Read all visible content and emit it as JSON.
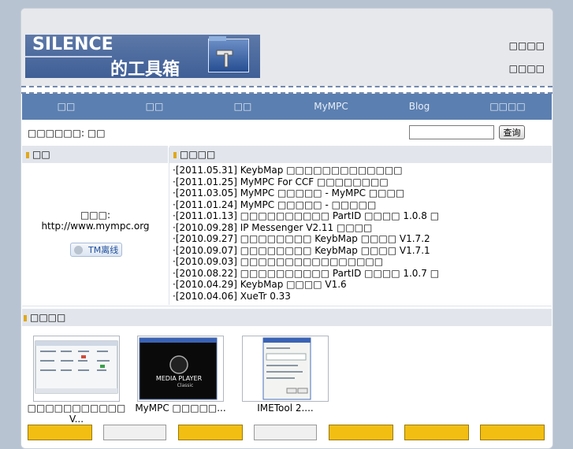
{
  "header": {
    "logo_line1": "SILENCE",
    "logo_line2": "的工具箱",
    "links": [
      "□□□□",
      "□□□□"
    ]
  },
  "nav": {
    "items": [
      "□□",
      "□□",
      "□□",
      "MyMPC",
      "Blog",
      "□□□□"
    ]
  },
  "location": {
    "label": "□□□□□□: □□",
    "search_value": "",
    "search_button": "查询"
  },
  "contact": {
    "heading": "□□",
    "label": "□□□:",
    "url": "http://www.mympc.org",
    "tm_status": "TM离线"
  },
  "news": {
    "heading": "□□□□",
    "items": [
      "·[2011.05.31] KeybMap □□□□□□□□□□□□□",
      "·[2011.01.25] MyMPC For CCF □□□□□□□□",
      "·[2011.03.05] MyMPC □□□□□ - MyMPC □□□□",
      "·[2011.01.24] MyMPC □□□□□ - □□□□□",
      "·[2011.01.13] □□□□□□□□□□ PartID □□□□ 1.0.8 □",
      "·[2010.09.28] IP Messenger V2.11 □□□□",
      "·[2010.09.27] □□□□□□□□ KeybMap □□□□ V1.7.2",
      "·[2010.09.07] □□□□□□□□ KeybMap □□□□ V1.7.1",
      "·[2010.09.03] □□□□□□□□□□□□□□□□",
      "·[2010.08.22] □□□□□□□□□□ PartID □□□□ 1.0.7 □",
      "·[2010.04.29] KeybMap □□□□ V1.6",
      "·[2010.04.06] XueTr 0.33"
    ]
  },
  "gallery": {
    "heading": "□□□□",
    "items": [
      {
        "caption": "□□□□□□□□□□□ V..."
      },
      {
        "caption": "MyMPC □□□□□..."
      },
      {
        "caption": "IMETool 2...."
      }
    ],
    "media_player_text": "MEDIA PLAYER",
    "media_player_sub": "Classic"
  },
  "colors": {
    "nav_bg": "#5b7fb0",
    "accent_mark": "#e0a81b",
    "bottom_button": "#f2be12"
  }
}
